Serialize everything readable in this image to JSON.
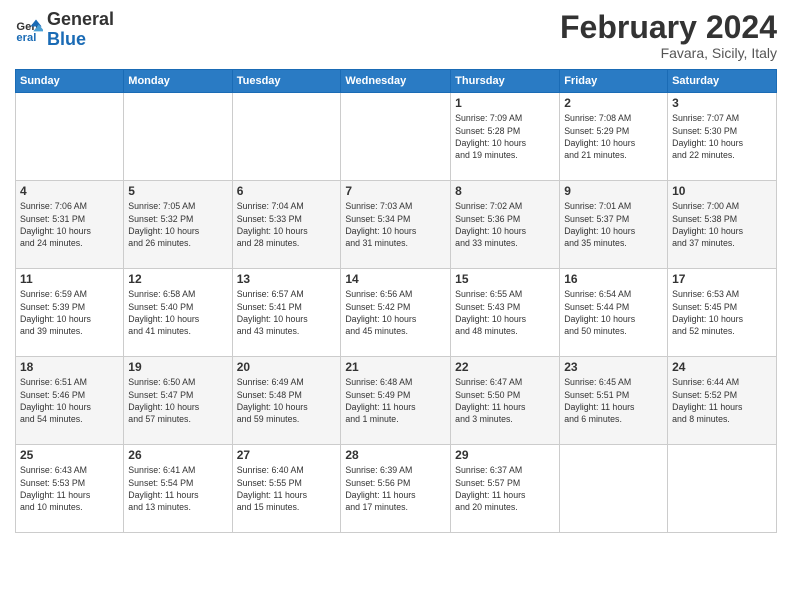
{
  "logo": {
    "line1": "General",
    "line2": "Blue"
  },
  "title": "February 2024",
  "location": "Favara, Sicily, Italy",
  "days_header": [
    "Sunday",
    "Monday",
    "Tuesday",
    "Wednesday",
    "Thursday",
    "Friday",
    "Saturday"
  ],
  "weeks": [
    [
      {
        "day": "",
        "info": ""
      },
      {
        "day": "",
        "info": ""
      },
      {
        "day": "",
        "info": ""
      },
      {
        "day": "",
        "info": ""
      },
      {
        "day": "1",
        "info": "Sunrise: 7:09 AM\nSunset: 5:28 PM\nDaylight: 10 hours\nand 19 minutes."
      },
      {
        "day": "2",
        "info": "Sunrise: 7:08 AM\nSunset: 5:29 PM\nDaylight: 10 hours\nand 21 minutes."
      },
      {
        "day": "3",
        "info": "Sunrise: 7:07 AM\nSunset: 5:30 PM\nDaylight: 10 hours\nand 22 minutes."
      }
    ],
    [
      {
        "day": "4",
        "info": "Sunrise: 7:06 AM\nSunset: 5:31 PM\nDaylight: 10 hours\nand 24 minutes."
      },
      {
        "day": "5",
        "info": "Sunrise: 7:05 AM\nSunset: 5:32 PM\nDaylight: 10 hours\nand 26 minutes."
      },
      {
        "day": "6",
        "info": "Sunrise: 7:04 AM\nSunset: 5:33 PM\nDaylight: 10 hours\nand 28 minutes."
      },
      {
        "day": "7",
        "info": "Sunrise: 7:03 AM\nSunset: 5:34 PM\nDaylight: 10 hours\nand 31 minutes."
      },
      {
        "day": "8",
        "info": "Sunrise: 7:02 AM\nSunset: 5:36 PM\nDaylight: 10 hours\nand 33 minutes."
      },
      {
        "day": "9",
        "info": "Sunrise: 7:01 AM\nSunset: 5:37 PM\nDaylight: 10 hours\nand 35 minutes."
      },
      {
        "day": "10",
        "info": "Sunrise: 7:00 AM\nSunset: 5:38 PM\nDaylight: 10 hours\nand 37 minutes."
      }
    ],
    [
      {
        "day": "11",
        "info": "Sunrise: 6:59 AM\nSunset: 5:39 PM\nDaylight: 10 hours\nand 39 minutes."
      },
      {
        "day": "12",
        "info": "Sunrise: 6:58 AM\nSunset: 5:40 PM\nDaylight: 10 hours\nand 41 minutes."
      },
      {
        "day": "13",
        "info": "Sunrise: 6:57 AM\nSunset: 5:41 PM\nDaylight: 10 hours\nand 43 minutes."
      },
      {
        "day": "14",
        "info": "Sunrise: 6:56 AM\nSunset: 5:42 PM\nDaylight: 10 hours\nand 45 minutes."
      },
      {
        "day": "15",
        "info": "Sunrise: 6:55 AM\nSunset: 5:43 PM\nDaylight: 10 hours\nand 48 minutes."
      },
      {
        "day": "16",
        "info": "Sunrise: 6:54 AM\nSunset: 5:44 PM\nDaylight: 10 hours\nand 50 minutes."
      },
      {
        "day": "17",
        "info": "Sunrise: 6:53 AM\nSunset: 5:45 PM\nDaylight: 10 hours\nand 52 minutes."
      }
    ],
    [
      {
        "day": "18",
        "info": "Sunrise: 6:51 AM\nSunset: 5:46 PM\nDaylight: 10 hours\nand 54 minutes."
      },
      {
        "day": "19",
        "info": "Sunrise: 6:50 AM\nSunset: 5:47 PM\nDaylight: 10 hours\nand 57 minutes."
      },
      {
        "day": "20",
        "info": "Sunrise: 6:49 AM\nSunset: 5:48 PM\nDaylight: 10 hours\nand 59 minutes."
      },
      {
        "day": "21",
        "info": "Sunrise: 6:48 AM\nSunset: 5:49 PM\nDaylight: 11 hours\nand 1 minute."
      },
      {
        "day": "22",
        "info": "Sunrise: 6:47 AM\nSunset: 5:50 PM\nDaylight: 11 hours\nand 3 minutes."
      },
      {
        "day": "23",
        "info": "Sunrise: 6:45 AM\nSunset: 5:51 PM\nDaylight: 11 hours\nand 6 minutes."
      },
      {
        "day": "24",
        "info": "Sunrise: 6:44 AM\nSunset: 5:52 PM\nDaylight: 11 hours\nand 8 minutes."
      }
    ],
    [
      {
        "day": "25",
        "info": "Sunrise: 6:43 AM\nSunset: 5:53 PM\nDaylight: 11 hours\nand 10 minutes."
      },
      {
        "day": "26",
        "info": "Sunrise: 6:41 AM\nSunset: 5:54 PM\nDaylight: 11 hours\nand 13 minutes."
      },
      {
        "day": "27",
        "info": "Sunrise: 6:40 AM\nSunset: 5:55 PM\nDaylight: 11 hours\nand 15 minutes."
      },
      {
        "day": "28",
        "info": "Sunrise: 6:39 AM\nSunset: 5:56 PM\nDaylight: 11 hours\nand 17 minutes."
      },
      {
        "day": "29",
        "info": "Sunrise: 6:37 AM\nSunset: 5:57 PM\nDaylight: 11 hours\nand 20 minutes."
      },
      {
        "day": "",
        "info": ""
      },
      {
        "day": "",
        "info": ""
      }
    ]
  ]
}
